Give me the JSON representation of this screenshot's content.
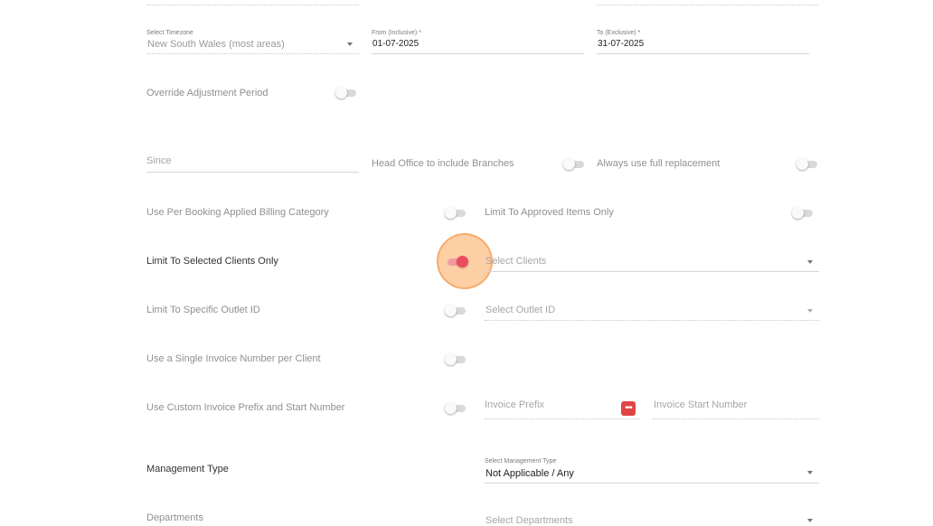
{
  "colors": {
    "accent": "#ea4e5c",
    "toggle_off": "#d9d9d9",
    "ripple": "#fcb26e",
    "more_button": "#e04545"
  },
  "timezone": {
    "label": "Select Timezone",
    "value": "New South Wales (most areas)"
  },
  "date_from": {
    "label": "From (Inclusive) *",
    "value": "01-07-2025"
  },
  "date_to": {
    "label": "To (Exclusive) *",
    "value": "31-07-2025"
  },
  "override_adjustment": {
    "label": "Override Adjustment Period",
    "on": false
  },
  "since": {
    "placeholder": "Since"
  },
  "head_office": {
    "label": "Head Office to include Branches",
    "on": false
  },
  "full_replacement": {
    "label": "Always use full replacement",
    "on": false
  },
  "per_booking_billing": {
    "label": "Use Per Booking Applied Billing Category",
    "on": false
  },
  "approved_items": {
    "label": "Limit To Approved Items Only",
    "on": false
  },
  "selected_clients": {
    "label": "Limit To Selected Clients Only",
    "on": true,
    "select_placeholder": "Select Clients"
  },
  "specific_outlet": {
    "label": "Limit To Specific Outlet ID",
    "on": false,
    "select_placeholder": "Select Outlet ID"
  },
  "single_invoice": {
    "label": "Use a Single Invoice Number per Client",
    "on": false
  },
  "custom_prefix": {
    "label": "Use Custom Invoice Prefix and Start Number",
    "on": false,
    "prefix_placeholder": "Invoice Prefix",
    "start_placeholder": "Invoice Start Number",
    "more_icon": "more-horizontal-icon"
  },
  "management_type": {
    "label": "Management Type",
    "select_label": "Select Management Type",
    "value": "Not Applicable / Any"
  },
  "departments": {
    "label": "Departments",
    "select_placeholder": "Select Departments"
  }
}
